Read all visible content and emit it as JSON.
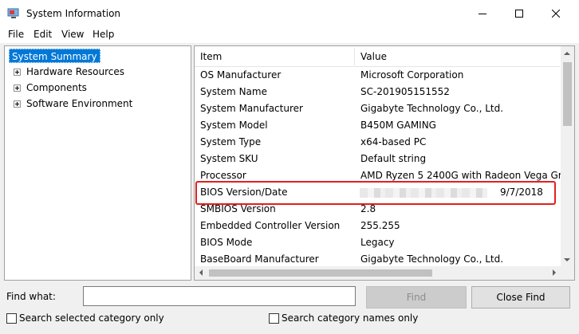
{
  "window": {
    "title": "System Information",
    "controls": {
      "minimize": "minimize",
      "maximize": "maximize",
      "close": "close"
    }
  },
  "menu": [
    "File",
    "Edit",
    "View",
    "Help"
  ],
  "tree": {
    "selected": "System Summary",
    "children": [
      "Hardware Resources",
      "Components",
      "Software Environment"
    ]
  },
  "table": {
    "headers": {
      "item": "Item",
      "value": "Value"
    },
    "rows": [
      {
        "item": "OS Manufacturer",
        "value": "Microsoft Corporation"
      },
      {
        "item": "System Name",
        "value": "SC-201905151552"
      },
      {
        "item": "System Manufacturer",
        "value": "Gigabyte Technology Co., Ltd."
      },
      {
        "item": "System Model",
        "value": "B450M GAMING"
      },
      {
        "item": "System Type",
        "value": "x64-based PC"
      },
      {
        "item": "System SKU",
        "value": "Default string"
      },
      {
        "item": "Processor",
        "value": "AMD Ryzen 5 2400G with Radeon Vega Gra"
      },
      {
        "item": "BIOS Version/Date",
        "value": "9/7/2018"
      },
      {
        "item": "SMBIOS Version",
        "value": "2.8"
      },
      {
        "item": "Embedded Controller Version",
        "value": "255.255"
      },
      {
        "item": "BIOS Mode",
        "value": "Legacy"
      },
      {
        "item": "BaseBoard Manufacturer",
        "value": "Gigabyte Technology Co., Ltd."
      }
    ]
  },
  "find": {
    "label": "Find what:",
    "value": "",
    "find_button": "Find",
    "close_find_button": "Close Find",
    "search_selected_label": "Search selected category only",
    "search_names_label": "Search category names only"
  },
  "colors": {
    "selection": "#0078d7",
    "highlight_box": "#e02020"
  }
}
